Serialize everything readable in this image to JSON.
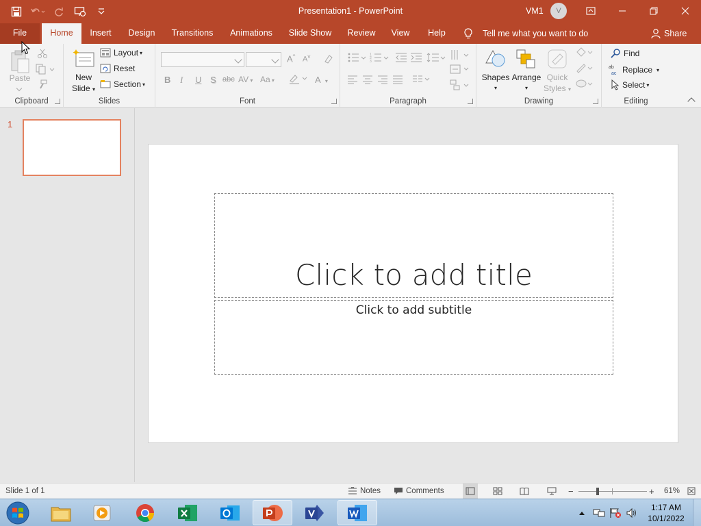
{
  "window": {
    "title": "Presentation1  -  PowerPoint",
    "user": "VM1",
    "avatar_initial": "V"
  },
  "tabs": [
    {
      "label": "File"
    },
    {
      "label": "Home"
    },
    {
      "label": "Insert"
    },
    {
      "label": "Design"
    },
    {
      "label": "Transitions"
    },
    {
      "label": "Animations"
    },
    {
      "label": "Slide Show"
    },
    {
      "label": "Review"
    },
    {
      "label": "View"
    },
    {
      "label": "Help"
    }
  ],
  "active_tab": "Home",
  "tell_me": "Tell me what you want to do",
  "share": "Share",
  "ribbon": {
    "clipboard": {
      "label": "Clipboard",
      "paste": "Paste"
    },
    "slides": {
      "label": "Slides",
      "new_slide_1": "New",
      "new_slide_2": "Slide",
      "layout": "Layout",
      "reset": "Reset",
      "section": "Section"
    },
    "font": {
      "label": "Font",
      "bold": "B",
      "italic": "I",
      "underline": "U",
      "shadow": "S",
      "strike": "abc",
      "spacing": "AV",
      "case": "Aa",
      "color": "A",
      "grow": "A",
      "shrink": "A"
    },
    "paragraph": {
      "label": "Paragraph"
    },
    "drawing": {
      "label": "Drawing",
      "shapes": "Shapes",
      "arrange": "Arrange",
      "quick_styles_1": "Quick",
      "quick_styles_2": "Styles"
    },
    "editing": {
      "label": "Editing",
      "find": "Find",
      "replace": "Replace",
      "select": "Select"
    }
  },
  "slides_pane": {
    "number": "1"
  },
  "slide": {
    "title_placeholder": "Click to add title",
    "subtitle_placeholder": "Click to add subtitle"
  },
  "statusbar": {
    "slide_info": "Slide 1 of 1",
    "notes": "Notes",
    "comments": "Comments",
    "zoom": "61%"
  },
  "taskbar": {
    "apps": [
      "file-explorer",
      "media-player",
      "chrome",
      "excel",
      "outlook",
      "powerpoint",
      "visio",
      "word"
    ],
    "time": "1:17 AM",
    "date": "10/1/2022"
  },
  "colors": {
    "accent": "#b7472a",
    "ribbon_bg": "#f3f3f3",
    "workspace_bg": "#e6e6e6",
    "thumb_border": "#e4825f"
  }
}
